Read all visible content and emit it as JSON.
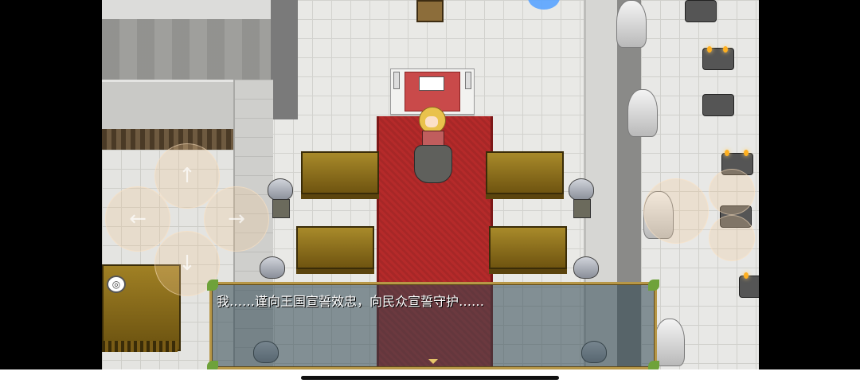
{
  "dialogue": {
    "text": "我……谨向王国宣誓效忠，向民众宣誓守护……"
  },
  "controls": {
    "dpad_up_icon": "arrow-up-icon",
    "dpad_down_icon": "arrow-down-icon",
    "dpad_left_icon": "arrow-left-icon",
    "dpad_right_icon": "arrow-right-icon"
  },
  "colors": {
    "carpet": "#b52a2a",
    "dialogue_border": "#b79747",
    "dialogue_text": "#ffffff"
  }
}
